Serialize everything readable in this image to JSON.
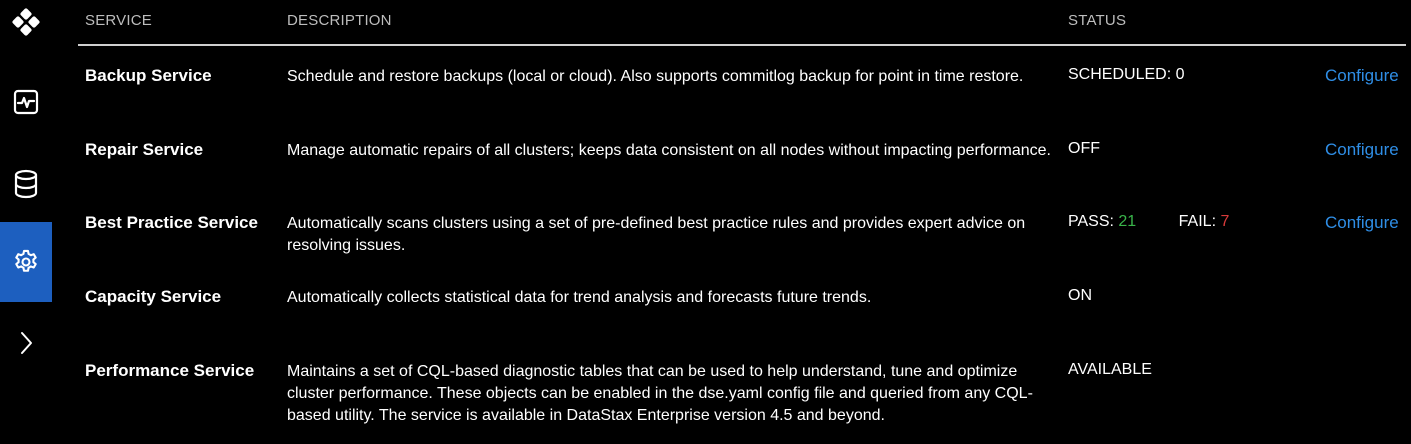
{
  "sidebar": {
    "icons": [
      "logo-icon",
      "activity-icon",
      "database-icon",
      "gear-icon",
      "chevron-right-icon"
    ],
    "active_color": "#1d5fbf"
  },
  "table": {
    "headers": {
      "service": "SERVICE",
      "description": "DESCRIPTION",
      "status": "STATUS"
    },
    "rows": [
      {
        "name": "Backup Service",
        "description": "Schedule and restore backups (local or cloud). Also supports commitlog backup for point in time restore.",
        "status": "SCHEDULED: 0",
        "action": "Configure"
      },
      {
        "name": "Repair Service",
        "description": "Manage automatic repairs of all clusters; keeps data consistent on all nodes without impacting performance.",
        "status": "OFF",
        "action": "Configure"
      },
      {
        "name": "Best Practice Service",
        "description": "Automatically scans clusters using a set of pre-defined best practice rules and provides expert advice on resolving issues.",
        "status_pass_label": "PASS:",
        "status_pass_value": "21",
        "status_fail_label": "FAIL:",
        "status_fail_value": "7",
        "action": "Configure"
      },
      {
        "name": "Capacity Service",
        "description": "Automatically collects statistical data for trend analysis and forecasts future trends.",
        "status": "ON"
      },
      {
        "name": "Performance Service",
        "description": "Maintains a set of CQL-based diagnostic tables that can be used to help understand, tune and optimize cluster performance. These objects can be enabled in the dse.yaml config file and queried from any CQL-based utility. The service is available in DataStax Enterprise version 4.5 and beyond.",
        "status": "AVAILABLE"
      }
    ]
  },
  "colors": {
    "background": "#000000",
    "link": "#2f8ee6",
    "pass": "#39b54a",
    "fail": "#d83a3a"
  }
}
